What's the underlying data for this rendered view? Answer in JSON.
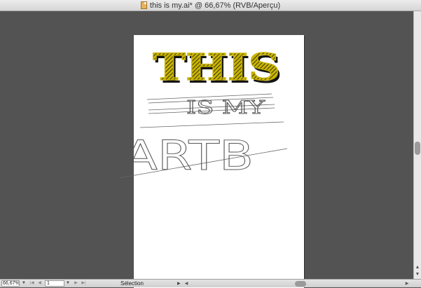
{
  "window": {
    "title": "this is my.ai* @ 66,67% (RVB/Aperçu)",
    "file_icon": "illustrator-document-icon"
  },
  "artwork": {
    "line1": "THIS",
    "line2": "IS MY",
    "line3": "ARTB",
    "accent_color": "#c9b400",
    "shadow_color": "#141414"
  },
  "statusbar": {
    "zoom": "66,67%",
    "page": "1",
    "status_label": "Sélection",
    "first_icon": "first-page-icon",
    "prev_icon": "previous-page-icon",
    "next_icon": "next-page-icon",
    "last_icon": "last-page-icon"
  },
  "colors": {
    "workspace": "#535353",
    "artboard": "#ffffff"
  }
}
